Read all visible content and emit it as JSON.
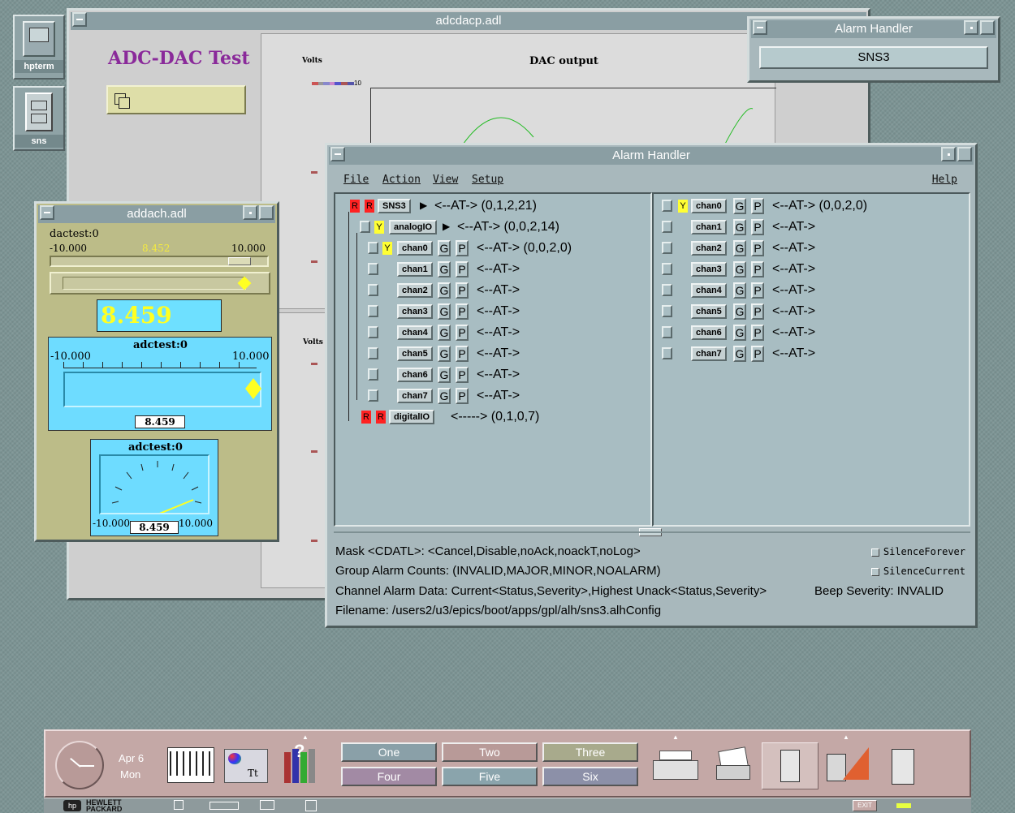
{
  "desktop_icons": [
    {
      "label": "hpterm",
      "icon": "terminal-icon"
    },
    {
      "label": "sns",
      "icon": "file-cabinet-icon"
    }
  ],
  "adc_window": {
    "title": "adcdacp.adl",
    "heading": "ADC-DAC Test",
    "volts_label_top": "Volts",
    "volts_label_bottom": "Volts",
    "plot_title": "DAC output",
    "y_top_tick": "10"
  },
  "small_alarm": {
    "title": "Alarm Handler",
    "button": "SNS3"
  },
  "addach": {
    "title": "addach.adl",
    "slider_label": "dactest:0",
    "slider_min": "-10.000",
    "slider_max": "10.000",
    "slider_value": "8.452",
    "slider_level": 0.92,
    "big_value": "8.459",
    "bar_label": "adctest:0",
    "bar_min": "-10.000",
    "bar_max": "10.000",
    "bar_value": "8.459",
    "meter_label": "adctest:0",
    "meter_min": "-10.000",
    "meter_max": "10.000",
    "meter_value": "8.459"
  },
  "alarm": {
    "title": "Alarm Handler",
    "menu": {
      "file": "File",
      "action": "Action",
      "view": "View",
      "setup": "Setup",
      "help": "Help"
    },
    "tree": {
      "sns3": {
        "name": "SNS3",
        "text": "<--AT-> (0,1,2,21)"
      },
      "analogio": {
        "name": "analogIO",
        "text": "<--AT-> (0,0,2,14)"
      },
      "chan0": {
        "name": "chan0",
        "text": "<--AT-> (0,0,2,0)"
      },
      "chan1": {
        "name": "chan1",
        "text": "<--AT->"
      },
      "chan2": {
        "name": "chan2",
        "text": "<--AT->"
      },
      "chan3": {
        "name": "chan3",
        "text": "<--AT->"
      },
      "chan4": {
        "name": "chan4",
        "text": "<--AT->"
      },
      "chan5": {
        "name": "chan5",
        "text": "<--AT->"
      },
      "chan6": {
        "name": "chan6",
        "text": "<--AT->"
      },
      "chan7": {
        "name": "chan7",
        "text": "<--AT->"
      },
      "digitalio": {
        "name": "digitalIO",
        "text": "<-----> (0,1,0,7)"
      }
    },
    "right": {
      "chan0": {
        "name": "chan0",
        "text": "<--AT-> (0,0,2,0)"
      },
      "chan1": {
        "name": "chan1",
        "text": "<--AT->"
      },
      "chan2": {
        "name": "chan2",
        "text": "<--AT->"
      },
      "chan3": {
        "name": "chan3",
        "text": "<--AT->"
      },
      "chan4": {
        "name": "chan4",
        "text": "<--AT->"
      },
      "chan5": {
        "name": "chan5",
        "text": "<--AT->"
      },
      "chan6": {
        "name": "chan6",
        "text": "<--AT->"
      },
      "chan7": {
        "name": "chan7",
        "text": "<--AT->"
      }
    },
    "flags": {
      "r": "R",
      "y": "Y",
      "g": "G",
      "p": "P"
    },
    "status": {
      "mask": "Mask <CDATL>: <Cancel,Disable,noAck,noackT,noLog>",
      "group": "Group Alarm Counts: (INVALID,MAJOR,MINOR,NOALARM)",
      "channel": "Channel Alarm Data: Current<Status,Severity>,Highest Unack<Status,Severity>",
      "beep": "Beep Severity: INVALID",
      "filename": "Filename: /users2/u3/epics/boot/apps/gpl/alh/sns3.alhConfig",
      "silence_forever": "SilenceForever",
      "silence_current": "SilenceCurrent"
    }
  },
  "panel": {
    "date_month_day": "Apr 6",
    "date_weekday": "Mon",
    "workspaces": [
      {
        "label": "One",
        "color": "#8aa0a8"
      },
      {
        "label": "Two",
        "color": "#b89a98"
      },
      {
        "label": "Three",
        "color": "#a8aa8c"
      },
      {
        "label": "Four",
        "color": "#a28aa4"
      },
      {
        "label": "Five",
        "color": "#8aa4ac"
      },
      {
        "label": "Six",
        "color": "#8c90a8"
      }
    ],
    "brand_line1": "HEWLETT",
    "brand_line2": "PACKARD",
    "exit": "EXIT"
  }
}
